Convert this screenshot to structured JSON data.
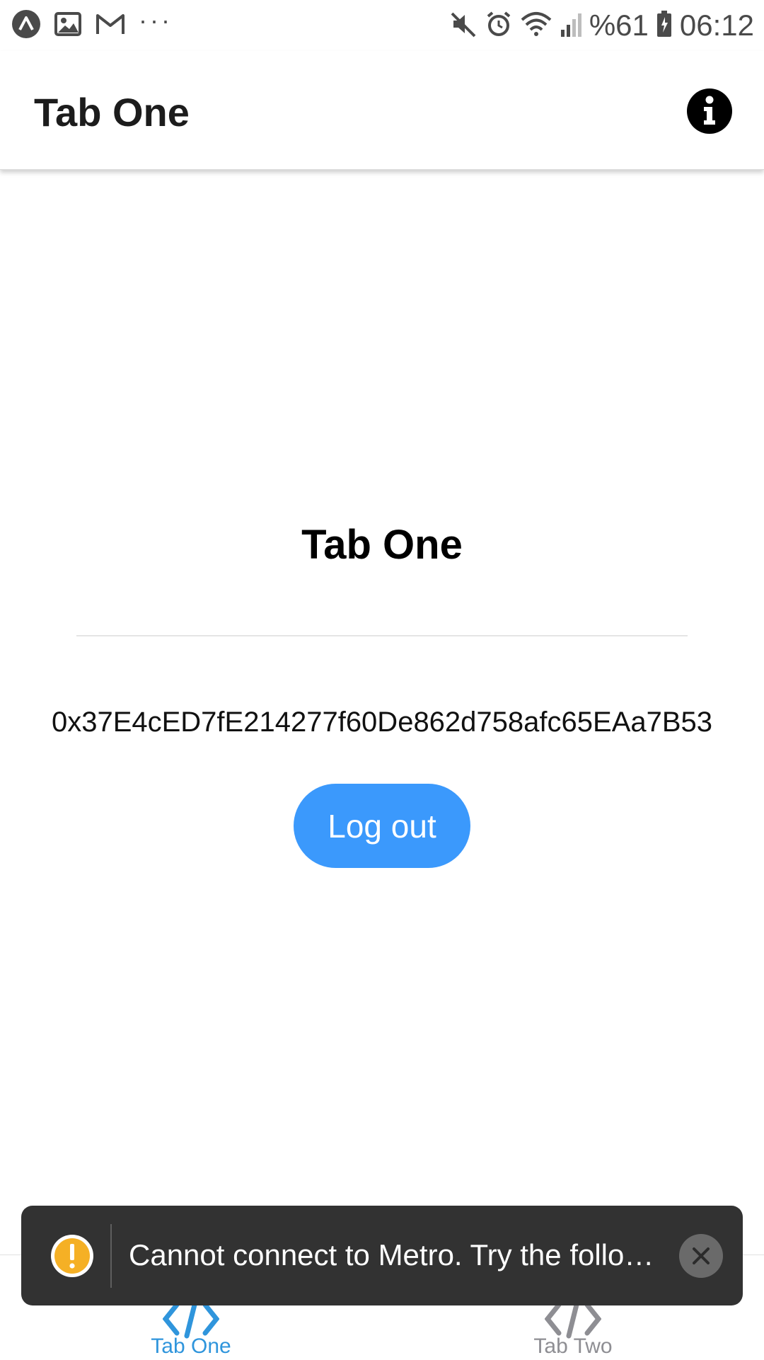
{
  "status_bar": {
    "left_icons": [
      "expo-icon",
      "image-icon",
      "gmail-icon",
      "more-dots-icon"
    ],
    "right_icons": [
      "mute-icon",
      "alarm-icon",
      "wifi-icon",
      "signal-icon",
      "battery-icon"
    ],
    "battery": "%61",
    "time": "06:12",
    "dots": "···"
  },
  "header": {
    "title": "Tab One",
    "info_icon": "info-icon"
  },
  "main": {
    "title": "Tab One",
    "address": "0x37E4cED7fE214277f60De862d758afc65EAa7B53",
    "logout_label": "Log out"
  },
  "toast": {
    "message": "Cannot connect to Metro.  Try the follo…",
    "warning_icon": "warning-icon",
    "close_icon": "close-icon"
  },
  "tabs": [
    {
      "label": "Tab One",
      "icon": "code-icon",
      "active": true
    },
    {
      "label": "Tab Two",
      "icon": "code-icon",
      "active": false
    }
  ],
  "colors": {
    "accent": "#2f95dc",
    "button": "#3b99fc",
    "toast_bg": "#323232",
    "warning": "#f5b025",
    "inactive": "#8e8e93"
  }
}
